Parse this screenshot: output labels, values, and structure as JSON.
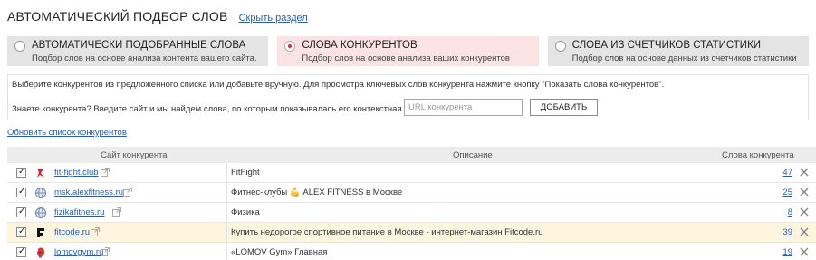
{
  "header": {
    "title": "АВТОМАТИЧЕСКИЙ ПОДБОР СЛОВ",
    "hide_link": "Скрыть раздел"
  },
  "tabs": [
    {
      "title": "АВТОМАТИЧЕСКИ ПОДОБРАННЫЕ СЛОВА",
      "subtitle": "Подбор слов на основе анализа контента вашего сайта.",
      "active": false
    },
    {
      "title": "СЛОВА КОНКУРЕНТОВ",
      "subtitle": "Подбор слов на основе анализа ваших конкурентов",
      "active": true
    },
    {
      "title": "СЛОВА ИЗ СЧЕТЧИКОВ СТАТИСТИКИ",
      "subtitle": "Подбор слов на основе данных из счетчиков статистики",
      "active": false
    }
  ],
  "panel": {
    "instruction": "Выберите конкурентов из предложенного списка или добавьте вручную. Для просмотра ключевых слов конкурента нажмите кнопку \"Показать слова конкурентов\".",
    "ask": "Знаете конкурента? Введите сайт и мы найдем слова, по которым показывалась его контекстная реклама:",
    "input_placeholder": "URL конкурента",
    "input_value": "",
    "add_button": "ДОБАВИТЬ"
  },
  "refresh_link": "Обновить список конкурентов",
  "table": {
    "headers": {
      "site": "Сайт конкурента",
      "description": "Описание",
      "words": "Слова конкурента"
    },
    "rows": [
      {
        "site": "fit-fight.club",
        "icon": "fitfight-logo-icon",
        "description": "FitFight",
        "count": "47",
        "checked": true,
        "highlight": false
      },
      {
        "site": "msk.alexfitness.ru",
        "icon": "globe-icon",
        "description": "Фитнес-клубы 💪 ALEX FITNESS в Москве",
        "count": "25",
        "checked": true,
        "highlight": false
      },
      {
        "site": "fizikafitnes.ru",
        "icon": "globe-icon",
        "description": "Физика",
        "count": "8",
        "checked": true,
        "highlight": false
      },
      {
        "site": "fitcode.ru",
        "icon": "fitcode-logo-icon",
        "description": "Купить недорогое спортивное питание в Москве - интернет-магазин Fitcode.ru",
        "count": "39",
        "checked": true,
        "highlight": true
      },
      {
        "site": "lomovgym.ru",
        "icon": "boxing-glove-icon",
        "description": "«LOMOV Gym» Главная",
        "count": "19",
        "checked": true,
        "highlight": false
      }
    ]
  }
}
